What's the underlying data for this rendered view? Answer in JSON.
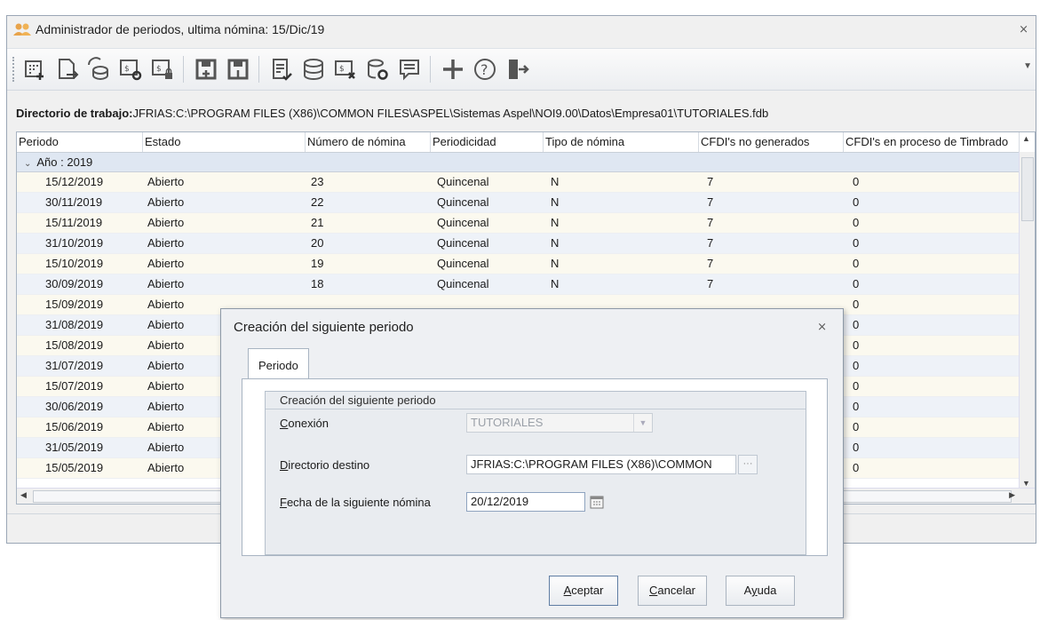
{
  "window": {
    "title": "Administrador de periodos, ultima nómina: 15/Dic/19",
    "close_glyph": "⨯"
  },
  "toolbar": {
    "icons": [
      "calendar-add-icon",
      "export-document-icon",
      "coins-refresh-icon",
      "payroll-settings-icon",
      "payroll-lock-icon",
      "save-open-icon",
      "save-close-icon",
      "document-check-icon",
      "database-coins-icon",
      "payroll-cancel-icon",
      "database-settings-icon",
      "message-icon",
      "add-icon",
      "help-icon",
      "exit-icon"
    ]
  },
  "workdir": {
    "label": "Directorio de trabajo:",
    "value": "JFRIAS:C:\\PROGRAM FILES (X86)\\COMMON FILES\\ASPEL\\Sistemas Aspel\\NOI9.00\\Datos\\Empresa01\\TUTORIALES.fdb"
  },
  "grid": {
    "columns": [
      "Periodo",
      "Estado",
      "Número de nómina",
      "Periodicidad",
      "Tipo de nómina",
      "CFDI's no generados",
      "CFDI's en proceso de Timbrado"
    ],
    "group_label": "Año : 2019",
    "rows": [
      [
        "15/12/2019",
        "Abierto",
        "23",
        "Quincenal",
        "N",
        "7",
        "0"
      ],
      [
        "30/11/2019",
        "Abierto",
        "22",
        "Quincenal",
        "N",
        "7",
        "0"
      ],
      [
        "15/11/2019",
        "Abierto",
        "21",
        "Quincenal",
        "N",
        "7",
        "0"
      ],
      [
        "31/10/2019",
        "Abierto",
        "20",
        "Quincenal",
        "N",
        "7",
        "0"
      ],
      [
        "15/10/2019",
        "Abierto",
        "19",
        "Quincenal",
        "N",
        "7",
        "0"
      ],
      [
        "30/09/2019",
        "Abierto",
        "18",
        "Quincenal",
        "N",
        "7",
        "0"
      ],
      [
        "15/09/2019",
        "Abierto",
        "",
        "",
        "",
        "",
        "0"
      ],
      [
        "31/08/2019",
        "Abierto",
        "",
        "",
        "",
        "",
        "0"
      ],
      [
        "15/08/2019",
        "Abierto",
        "",
        "",
        "",
        "",
        "0"
      ],
      [
        "31/07/2019",
        "Abierto",
        "",
        "",
        "",
        "",
        "0"
      ],
      [
        "15/07/2019",
        "Abierto",
        "",
        "",
        "",
        "",
        "0"
      ],
      [
        "30/06/2019",
        "Abierto",
        "",
        "",
        "",
        "",
        "0"
      ],
      [
        "15/06/2019",
        "Abierto",
        "",
        "",
        "",
        "",
        "0"
      ],
      [
        "31/05/2019",
        "Abierto",
        "",
        "",
        "",
        "",
        "0"
      ],
      [
        "15/05/2019",
        "Abierto",
        "",
        "",
        "",
        "",
        "0"
      ]
    ]
  },
  "dialog": {
    "title": "Creación del siguiente periodo",
    "close_glyph": "⨯",
    "tab": "Periodo",
    "group_title": "Creación del siguiente periodo",
    "conexion": {
      "label_u": "C",
      "label_rest": "onexión",
      "value": "TUTORIALES"
    },
    "directorio": {
      "label_u": "D",
      "label_rest": "irectorio destino",
      "value": "JFRIAS:C:\\PROGRAM FILES (X86)\\COMMON",
      "button": "···"
    },
    "fecha": {
      "label_u": "F",
      "label_rest": "echa de la siguiente nómina",
      "value": "20/12/2019"
    },
    "buttons": {
      "aceptar_u": "A",
      "aceptar_rest": "ceptar",
      "cancelar_u": "C",
      "cancelar_rest": "ancelar",
      "ayuda_pre": "A",
      "ayuda_u": "y",
      "ayuda_rest": "uda"
    }
  },
  "colors": {
    "accent": "#3d5f8a",
    "row_odd": "#fbf9ef",
    "row_even": "#eef2f8",
    "group": "#dfe7f2"
  }
}
